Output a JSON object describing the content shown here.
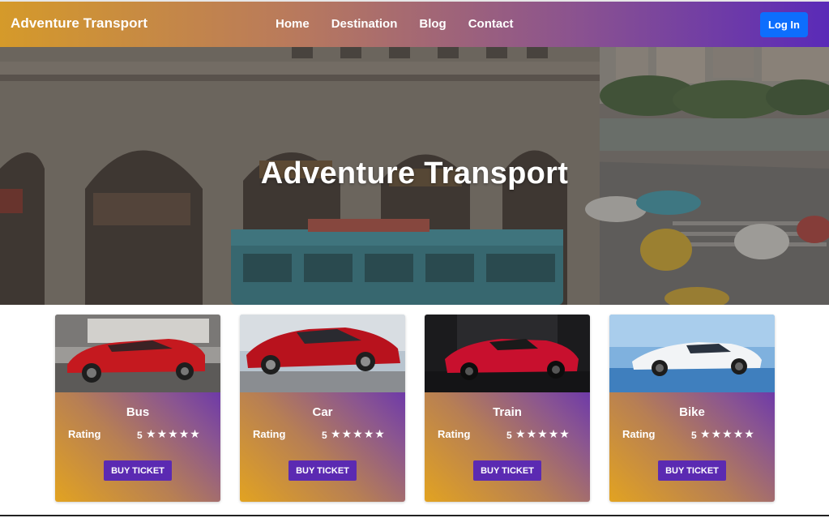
{
  "navbar": {
    "brand": "Adventure Transport",
    "links": [
      "Home",
      "Destination",
      "Blog",
      "Contact"
    ],
    "login_label": "Log In"
  },
  "hero": {
    "title": "Adventure Transport"
  },
  "cards": [
    {
      "title": "Bus",
      "rating_label": "Rating",
      "rating_value": "5",
      "stars": 5,
      "button": "BUY TICKET",
      "image": "red-mustang-car-image"
    },
    {
      "title": "Car",
      "rating_label": "Rating",
      "rating_value": "5",
      "stars": 5,
      "button": "BUY TICKET",
      "image": "red-sedan-car-image"
    },
    {
      "title": "Train",
      "rating_label": "Rating",
      "rating_value": "5",
      "stars": 5,
      "button": "BUY TICKET",
      "image": "red-sports-car-image"
    },
    {
      "title": "Bike",
      "rating_label": "Rating",
      "rating_value": "5",
      "stars": 5,
      "button": "BUY TICKET",
      "image": "white-supercar-image"
    }
  ],
  "colors": {
    "nav_gradient_start": "#d59a2a",
    "nav_gradient_end": "#5a2ab8",
    "login_button": "#0d6efd",
    "buy_button": "#5b2ab2",
    "card_gradient_start": "#e2a321",
    "card_gradient_end": "#6e3aa8"
  }
}
